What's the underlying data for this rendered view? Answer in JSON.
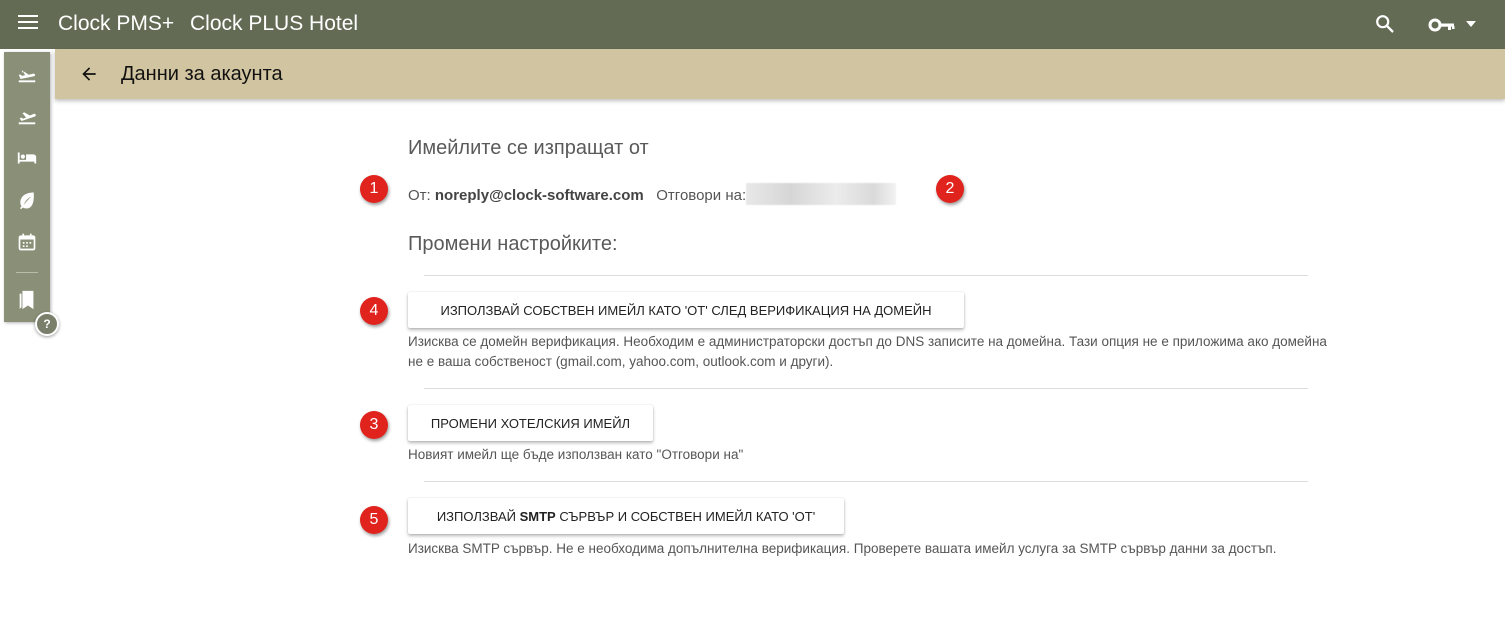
{
  "topbar": {
    "app_name": "Clock PMS+",
    "hotel_name": "Clock PLUS Hotel",
    "icons": [
      "menu-icon",
      "search-icon",
      "key-icon",
      "caret-down-icon"
    ]
  },
  "sidebar": {
    "icons": [
      "arrivals-icon",
      "departures-icon",
      "bed-icon",
      "leaf-icon",
      "calendar-icon",
      "bookmarks-icon"
    ],
    "help_label": "?"
  },
  "subheader": {
    "title": "Данни за акаунта"
  },
  "emails_section": {
    "title": "Имейлите се изпращат от",
    "from_label": "От:",
    "from_email": "noreply@clock-software.com",
    "reply_label": "Отговори на:"
  },
  "settings_section": {
    "title": "Промени настройките:"
  },
  "options": [
    {
      "button_label": "ИЗПОЛЗВАЙ СОБСТВЕН ИМЕЙЛ КАТО 'ОТ' СЛЕД ВЕРИФИКАЦИЯ НА ДОМЕЙН",
      "description": "Изисква се домейн верификация. Необходим е администраторски достъп до DNS записите на домейна. Тази опция не е приложима ако домейна не е ваша собственост (gmail.com, yahoo.com, outlook.com и други)."
    },
    {
      "button_label": "ПРОМЕНИ ХОТЕЛСКИЯ ИМЕЙЛ",
      "description": "Новият имейл ще бъде използван като \"Отговори на\""
    },
    {
      "button_label_pre": "ИЗПОЛЗВАЙ ",
      "button_label_bold": "SMTP",
      "button_label_post": " СЪРВЪР И СОБСТВЕН ИМЕЙЛ КАТО 'ОТ'",
      "description": "Изисква SMTP сървър. Не е необходима допълнителна верификация. Проверете вашата имейл услуга за SMTP сървър данни за достъп."
    }
  ],
  "badges": [
    "1",
    "2",
    "4",
    "3",
    "5"
  ],
  "colors": {
    "topbar": "#646b55",
    "subheader": "#d1c4a0",
    "sidebar": "#8a9078",
    "badge": "#e0231c"
  }
}
